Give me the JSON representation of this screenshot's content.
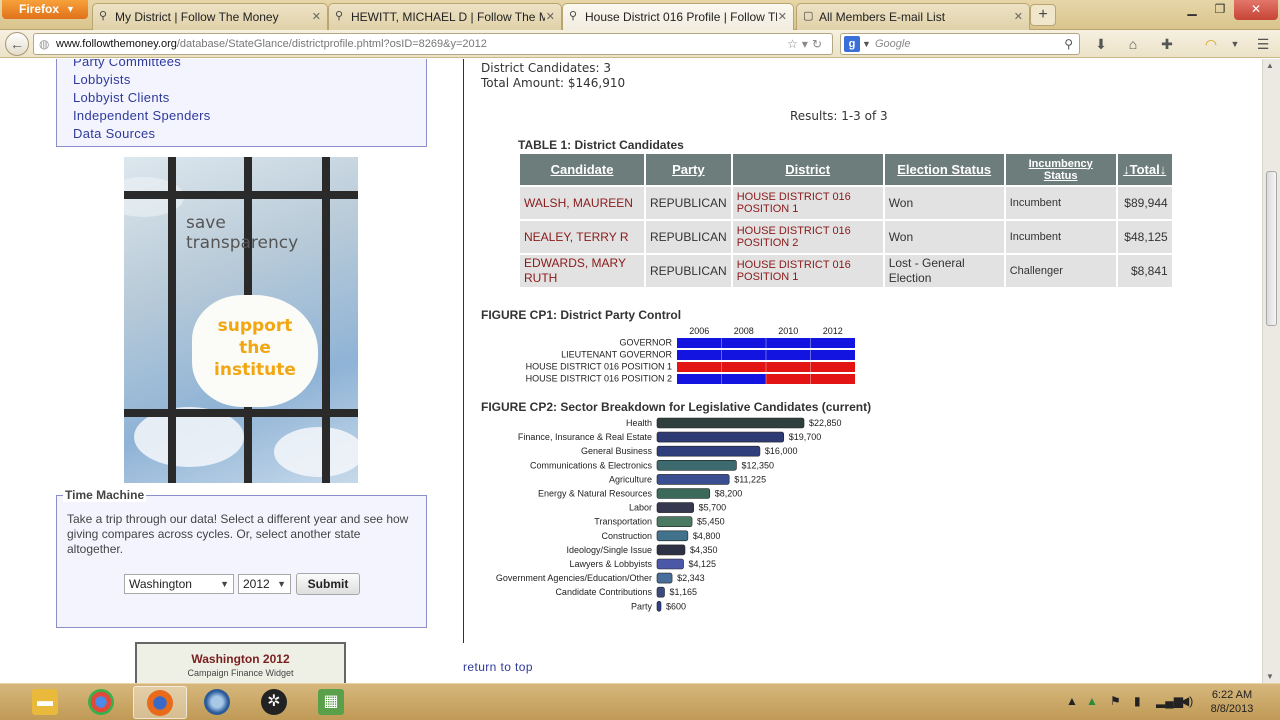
{
  "browser": {
    "app_button": "Firefox",
    "tabs": [
      {
        "title": "My District | Follow The Money",
        "active": false
      },
      {
        "title": "HEWITT, MICHAEL D | Follow The M...",
        "active": false
      },
      {
        "title": "House District 016 Profile | Follow Th...",
        "active": true
      },
      {
        "title": "All Members E-mail List",
        "active": false
      }
    ],
    "url_host": "www.followthemoney.org",
    "url_path": "/database/StateGlance/districtprofile.phtml?osID=8269&y=2012",
    "search_placeholder": "Google"
  },
  "left_nav": {
    "items": [
      {
        "label": "Party Committees"
      },
      {
        "label": "Lobbyists"
      },
      {
        "label": "Lobbyist Clients"
      },
      {
        "label": "Independent Spenders"
      },
      {
        "label": "Data Sources"
      }
    ]
  },
  "banner": {
    "line1": "save",
    "line2": "transparency",
    "support1": "support",
    "support2": "the",
    "support3": "institute"
  },
  "time_machine": {
    "legend": "Time Machine",
    "description": "Take a trip through our data! Select a different year and see how giving compares across cycles. Or, select another state altogether.",
    "state_value": "Washington",
    "year_value": "2012",
    "submit_label": "Submit"
  },
  "widget": {
    "title": "Washington 2012",
    "subtitle": "Campaign Finance Widget"
  },
  "summary": {
    "candidates": "District Candidates: 3",
    "total": "Total Amount: $146,910",
    "results": "Results: 1-3 of 3"
  },
  "table": {
    "title": "TABLE 1: District Candidates",
    "headers": {
      "candidate": "Candidate",
      "party": "Party",
      "district": "District",
      "status": "Election Status",
      "inc1": "Incumbency",
      "inc2": "Status",
      "total": "↓Total↓"
    },
    "rows": [
      {
        "candidate": "WALSH, MAUREEN",
        "party": "REPUBLICAN",
        "district1": "HOUSE DISTRICT 016",
        "district2": "POSITION 1",
        "status1": "Won",
        "status2": "",
        "incumbency": "Incumbent",
        "total": "$89,944"
      },
      {
        "candidate": "NEALEY, TERRY R",
        "party": "REPUBLICAN",
        "district1": "HOUSE DISTRICT 016",
        "district2": "POSITION 2",
        "status1": "Won",
        "status2": "",
        "incumbency": "Incumbent",
        "total": "$48,125"
      },
      {
        "candidate1": "EDWARDS, MARY",
        "candidate2": "RUTH",
        "party": "REPUBLICAN",
        "district1": "HOUSE DISTRICT 016",
        "district2": "POSITION 1",
        "status1": "Lost - General",
        "status2": "Election",
        "incumbency": "Challenger",
        "total": "$8,841"
      }
    ]
  },
  "figure1": {
    "title": "FIGURE CP1: District Party Control"
  },
  "figure2": {
    "title": "FIGURE CP2: Sector Breakdown for Legislative Candidates (current)"
  },
  "return_top": "return to top",
  "taskbar": {
    "time": "6:22 AM",
    "date": "8/8/2013"
  },
  "colors": {
    "republican": "#e21414",
    "democrat": "#1414e0",
    "header_bg": "#6d7d7b",
    "link": "#2e3a9b"
  },
  "chart_data": [
    {
      "type": "bar",
      "chart": "party_control_timeline",
      "x": [
        "2006",
        "2008",
        "2010",
        "2012"
      ],
      "rows": [
        {
          "label": "GOVERNOR",
          "segments": [
            {
              "from": 2005,
              "to": 2013,
              "party": "democrat"
            }
          ]
        },
        {
          "label": "LIEUTENANT GOVERNOR",
          "segments": [
            {
              "from": 2005,
              "to": 2013,
              "party": "democrat"
            }
          ]
        },
        {
          "label": "HOUSE DISTRICT 016 POSITION 1",
          "segments": [
            {
              "from": 2005,
              "to": 2013,
              "party": "republican"
            }
          ]
        },
        {
          "label": "HOUSE DISTRICT 016 POSITION 2",
          "segments": [
            {
              "from": 2005,
              "to": 2009,
              "party": "democrat"
            },
            {
              "from": 2009,
              "to": 2013,
              "party": "republican"
            }
          ]
        }
      ],
      "xlim": [
        2005,
        2013
      ]
    },
    {
      "type": "bar",
      "chart": "sector_breakdown",
      "categories": [
        "Health",
        "Finance, Insurance & Real Estate",
        "General Business",
        "Communications & Electronics",
        "Agriculture",
        "Energy & Natural Resources",
        "Labor",
        "Transportation",
        "Construction",
        "Ideology/Single Issue",
        "Lawyers & Lobbyists",
        "Government Agencies/Education/Other",
        "Candidate Contributions",
        "Party"
      ],
      "values": [
        22850,
        19700,
        16000,
        12350,
        11225,
        8200,
        5700,
        5450,
        4800,
        4350,
        4125,
        2343,
        1165,
        600
      ],
      "labels": [
        "$22,850",
        "$19,700",
        "$16,000",
        "$12,350",
        "$11,225",
        "$8,200",
        "$5,700",
        "$5,450",
        "$4,800",
        "$4,350",
        "$4,125",
        "$2,343",
        "$1,165",
        "$600"
      ],
      "colors": [
        "#2f3f3d",
        "#2d3a73",
        "#2f3f7e",
        "#3d6a6e",
        "#3a4f92",
        "#3c6a5a",
        "#35384e",
        "#4a7a62",
        "#41718b",
        "#2d3145",
        "#4b58a8",
        "#4a6e9a",
        "#3e4a7c",
        "#2d3f8e"
      ]
    }
  ]
}
